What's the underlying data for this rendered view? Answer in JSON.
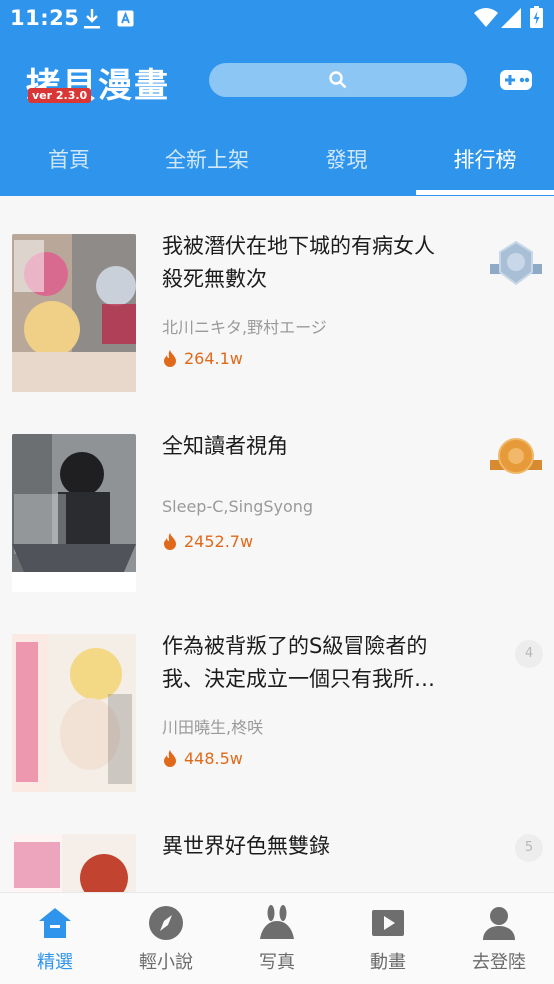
{
  "status_bar": {
    "time": "11:25"
  },
  "header": {
    "app_name": "拷貝漫畫",
    "version": "ver 2.3.0",
    "search_icon": "search-icon",
    "game_icon": "gamepad-icon",
    "accent_color": "#2f95ec"
  },
  "tabs": [
    {
      "label": "首頁",
      "active": false
    },
    {
      "label": "全新上架",
      "active": false
    },
    {
      "label": "發現",
      "active": false
    },
    {
      "label": "排行榜",
      "active": true
    }
  ],
  "ranking": [
    {
      "rank": 1,
      "title_line1": "我被潛伏在地下城的有病女人",
      "title_line2": "殺死無數次",
      "authors": "北川ニキタ,野村エージ",
      "heat": "264.1w",
      "badge": "silver-medal-icon"
    },
    {
      "rank": 2,
      "title_line1": "全知讀者視角",
      "title_line2": "",
      "authors": "Sleep-C,SingSyong",
      "heat": "2452.7w",
      "badge": "bronze-medal-icon"
    },
    {
      "rank": 3,
      "title_line1": "作為被背叛了的S級冒險者的",
      "title_line2": "我、決定成立一個只有我所…",
      "authors": "川田曉生,柊咲",
      "heat": "448.5w",
      "rank_label": "4"
    },
    {
      "rank": 4,
      "title_line1": "異世界好色無雙錄",
      "title_line2": "",
      "authors": "",
      "heat": "",
      "rank_label": "5"
    }
  ],
  "bottom_nav": [
    {
      "label": "精選",
      "icon": "home-icon",
      "active": true
    },
    {
      "label": "輕小說",
      "icon": "compass-icon",
      "active": false
    },
    {
      "label": "写真",
      "icon": "bunny-icon",
      "active": false
    },
    {
      "label": "動畫",
      "icon": "play-icon",
      "active": false
    },
    {
      "label": "去登陸",
      "icon": "user-icon",
      "active": false
    }
  ]
}
